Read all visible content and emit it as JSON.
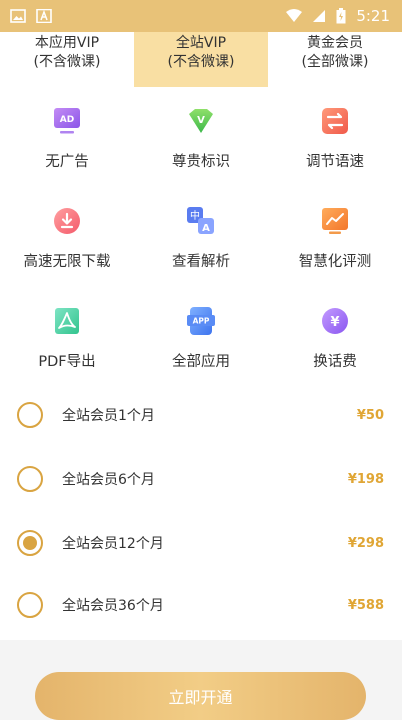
{
  "status_bar": {
    "time": "5:21"
  },
  "tabs": [
    {
      "line1": "本应用VIP",
      "line2": "(不含微课)",
      "active": false
    },
    {
      "line1": "全站VIP",
      "line2": "(不含微课)",
      "active": true
    },
    {
      "line1": "黄金会员",
      "line2": "(全部微课)",
      "active": false
    }
  ],
  "features": [
    {
      "label": "无广告",
      "icon": "ad-icon",
      "icon_text": "AD"
    },
    {
      "label": "尊贵标识",
      "icon": "vip-badge-icon",
      "icon_text": "V"
    },
    {
      "label": "调节语速",
      "icon": "speed-adjust-icon"
    },
    {
      "label": "高速无限下载",
      "icon": "download-icon"
    },
    {
      "label": "查看解析",
      "icon": "translate-icon",
      "icon_text": "中",
      "icon_text2": "A"
    },
    {
      "label": "智慧化评测",
      "icon": "chart-icon"
    },
    {
      "label": "PDF导出",
      "icon": "pdf-icon"
    },
    {
      "label": "全部应用",
      "icon": "app-icon",
      "icon_text": "APP"
    },
    {
      "label": "换话费",
      "icon": "yen-icon",
      "icon_text": "¥"
    }
  ],
  "plans": [
    {
      "name": "全站会员1个月",
      "price": "¥50",
      "selected": false
    },
    {
      "name": "全站会员6个月",
      "price": "¥198",
      "selected": false
    },
    {
      "name": "全站会员12个月",
      "price": "¥298",
      "selected": true
    },
    {
      "name": "全站会员36个月",
      "price": "¥588",
      "selected": false
    }
  ],
  "cta": {
    "label": "立即开通"
  },
  "colors": {
    "status_bar": "#e8c278",
    "active_tab": "#f9dfa3",
    "accent": "#d9a441",
    "price": "#e0a635"
  }
}
